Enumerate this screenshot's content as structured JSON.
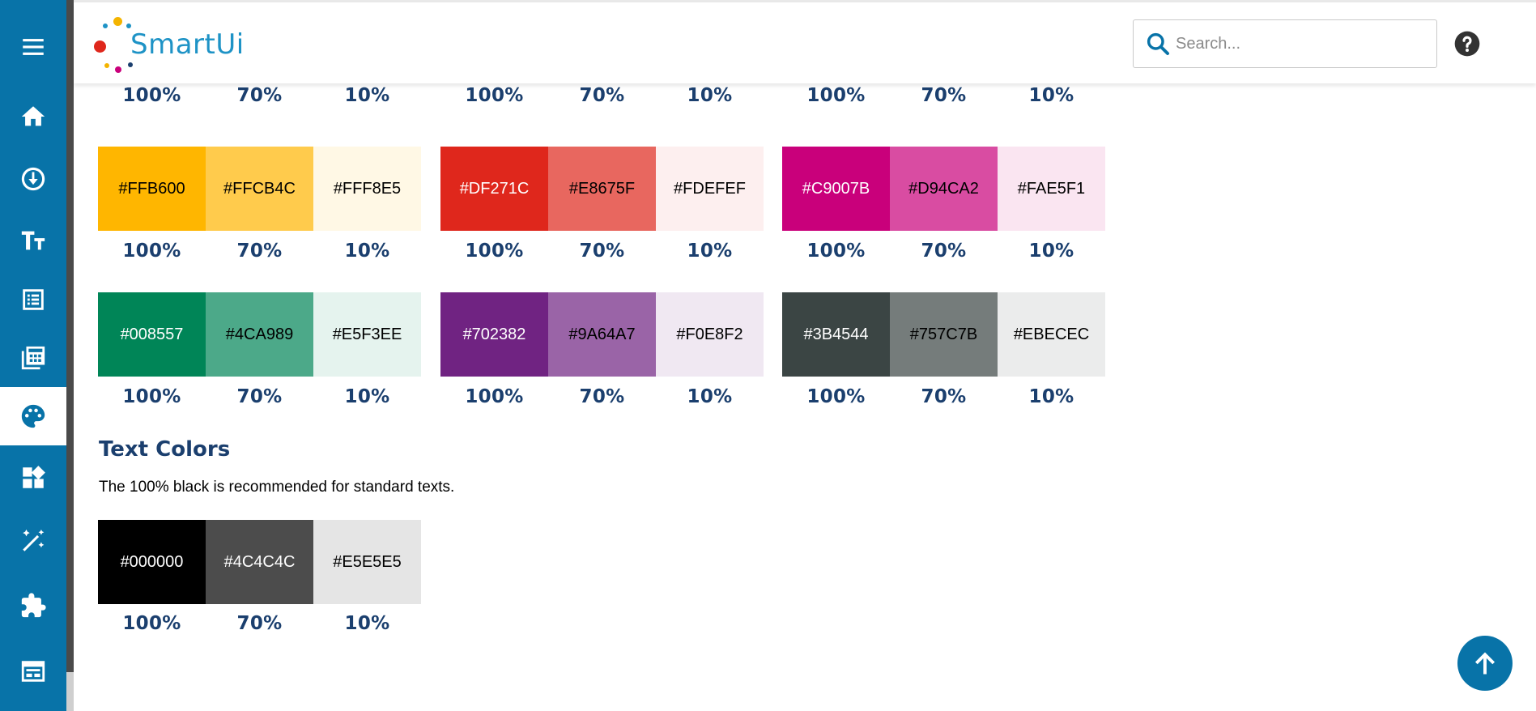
{
  "app": {
    "logo_text": "SmartUi"
  },
  "search": {
    "placeholder": "Search..."
  },
  "sidebar": {
    "items": [
      {
        "icon": "menu-icon"
      },
      {
        "icon": "home-icon"
      },
      {
        "icon": "download-circle-icon"
      },
      {
        "icon": "typography-icon"
      },
      {
        "icon": "list-document-icon"
      },
      {
        "icon": "calculator-icon"
      },
      {
        "icon": "palette-icon",
        "active": true
      },
      {
        "icon": "widgets-icon"
      },
      {
        "icon": "magic-wand-icon"
      },
      {
        "icon": "puzzle-icon"
      },
      {
        "icon": "layout-icon"
      }
    ]
  },
  "top_partial_row": {
    "labels": [
      "100%",
      "70%",
      "10%",
      "100%",
      "70%",
      "10%",
      "100%",
      "70%",
      "10%"
    ]
  },
  "palette_rows": [
    {
      "swatches": [
        {
          "hex": "#FFB600",
          "bg": "#FFB600",
          "fg": "#000000"
        },
        {
          "hex": "#FFCB4C",
          "bg": "#FFCB4C",
          "fg": "#000000"
        },
        {
          "hex": "#FFF8E5",
          "bg": "#FFF8E5",
          "fg": "#000000"
        },
        {
          "hex": "#DF271C",
          "bg": "#DF271C",
          "fg": "#FFFFFF"
        },
        {
          "hex": "#E8675F",
          "bg": "#E8675F",
          "fg": "#000000"
        },
        {
          "hex": "#FDEFEF",
          "bg": "#FDEFEF",
          "fg": "#000000"
        },
        {
          "hex": "#C9007B",
          "bg": "#C9007B",
          "fg": "#FFFFFF"
        },
        {
          "hex": "#D94CA2",
          "bg": "#D94CA2",
          "fg": "#000000"
        },
        {
          "hex": "#FAE5F1",
          "bg": "#FAE5F1",
          "fg": "#000000"
        }
      ],
      "labels": [
        "100%",
        "70%",
        "10%",
        "100%",
        "70%",
        "10%",
        "100%",
        "70%",
        "10%"
      ]
    },
    {
      "swatches": [
        {
          "hex": "#008557",
          "bg": "#008557",
          "fg": "#FFFFFF"
        },
        {
          "hex": "#4CA989",
          "bg": "#4CA989",
          "fg": "#000000"
        },
        {
          "hex": "#E5F3EE",
          "bg": "#E5F3EE",
          "fg": "#000000"
        },
        {
          "hex": "#702382",
          "bg": "#702382",
          "fg": "#FFFFFF"
        },
        {
          "hex": "#9A64A7",
          "bg": "#9A64A7",
          "fg": "#000000"
        },
        {
          "hex": "#F0E8F2",
          "bg": "#F0E8F2",
          "fg": "#000000"
        },
        {
          "hex": "#3B4544",
          "bg": "#3B4544",
          "fg": "#FFFFFF"
        },
        {
          "hex": "#757C7B",
          "bg": "#757C7B",
          "fg": "#000000"
        },
        {
          "hex": "#EBECEC",
          "bg": "#EBECEC",
          "fg": "#000000"
        }
      ],
      "labels": [
        "100%",
        "70%",
        "10%",
        "100%",
        "70%",
        "10%",
        "100%",
        "70%",
        "10%"
      ]
    }
  ],
  "text_colors": {
    "title": "Text Colors",
    "description": "The 100% black is recommended for standard texts.",
    "swatches": [
      {
        "hex": "#000000",
        "bg": "#000000",
        "fg": "#FFFFFF"
      },
      {
        "hex": "#4C4C4C",
        "bg": "#4C4C4C",
        "fg": "#FFFFFF"
      },
      {
        "hex": "#E5E5E5",
        "bg": "#E5E5E5",
        "fg": "#000000"
      }
    ],
    "labels": [
      "100%",
      "70%",
      "10%"
    ]
  },
  "colors": {
    "sidebar": "#0873A8",
    "heading": "#1B3F6E",
    "accent": "#0873A8"
  }
}
